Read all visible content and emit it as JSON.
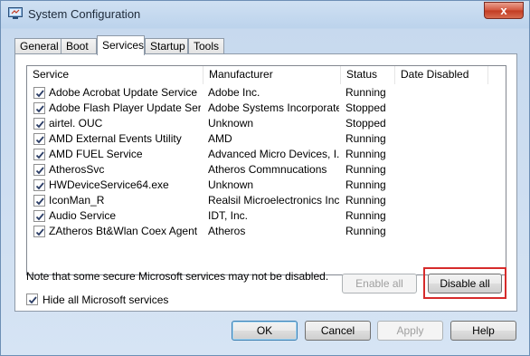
{
  "window": {
    "title": "System Configuration",
    "close_glyph": "x"
  },
  "tabs": [
    {
      "label": "General",
      "active": false
    },
    {
      "label": "Boot",
      "active": false
    },
    {
      "label": "Services",
      "active": true
    },
    {
      "label": "Startup",
      "active": false
    },
    {
      "label": "Tools",
      "active": false
    }
  ],
  "services_list": {
    "columns": [
      "Service",
      "Manufacturer",
      "Status",
      "Date Disabled"
    ],
    "rows": [
      {
        "checked": true,
        "service": "Adobe Acrobat Update Service",
        "manufacturer": "Adobe Inc.",
        "status": "Running",
        "date_disabled": ""
      },
      {
        "checked": true,
        "service": "Adobe Flash Player Update Service",
        "manufacturer": "Adobe Systems Incorporated",
        "status": "Stopped",
        "date_disabled": ""
      },
      {
        "checked": true,
        "service": "airtel. OUC",
        "manufacturer": "Unknown",
        "status": "Stopped",
        "date_disabled": ""
      },
      {
        "checked": true,
        "service": "AMD External Events Utility",
        "manufacturer": "AMD",
        "status": "Running",
        "date_disabled": ""
      },
      {
        "checked": true,
        "service": "AMD FUEL Service",
        "manufacturer": "Advanced Micro Devices, I...",
        "status": "Running",
        "date_disabled": ""
      },
      {
        "checked": true,
        "service": "AtherosSvc",
        "manufacturer": "Atheros Commnucations",
        "status": "Running",
        "date_disabled": ""
      },
      {
        "checked": true,
        "service": "HWDeviceService64.exe",
        "manufacturer": "Unknown",
        "status": "Running",
        "date_disabled": ""
      },
      {
        "checked": true,
        "service": "IconMan_R",
        "manufacturer": "Realsil Microelectronics Inc.",
        "status": "Running",
        "date_disabled": ""
      },
      {
        "checked": true,
        "service": "Audio Service",
        "manufacturer": "IDT, Inc.",
        "status": "Running",
        "date_disabled": ""
      },
      {
        "checked": true,
        "service": "ZAtheros Bt&Wlan Coex Agent",
        "manufacturer": "Atheros",
        "status": "Running",
        "date_disabled": ""
      }
    ]
  },
  "note": "Note that some secure Microsoft services may not be disabled.",
  "buttons": {
    "enable_all": "Enable all",
    "disable_all": "Disable all",
    "ok": "OK",
    "cancel": "Cancel",
    "apply": "Apply",
    "help": "Help"
  },
  "hide_ms": {
    "label": "Hide all Microsoft services",
    "checked": true
  },
  "colors": {
    "highlight": "#d62b2b",
    "titlebar": "#bcd3ec",
    "close": "#c23a21"
  },
  "icons": {
    "app": "system-config-icon",
    "close": "close-icon",
    "check": "checkmark-icon"
  }
}
